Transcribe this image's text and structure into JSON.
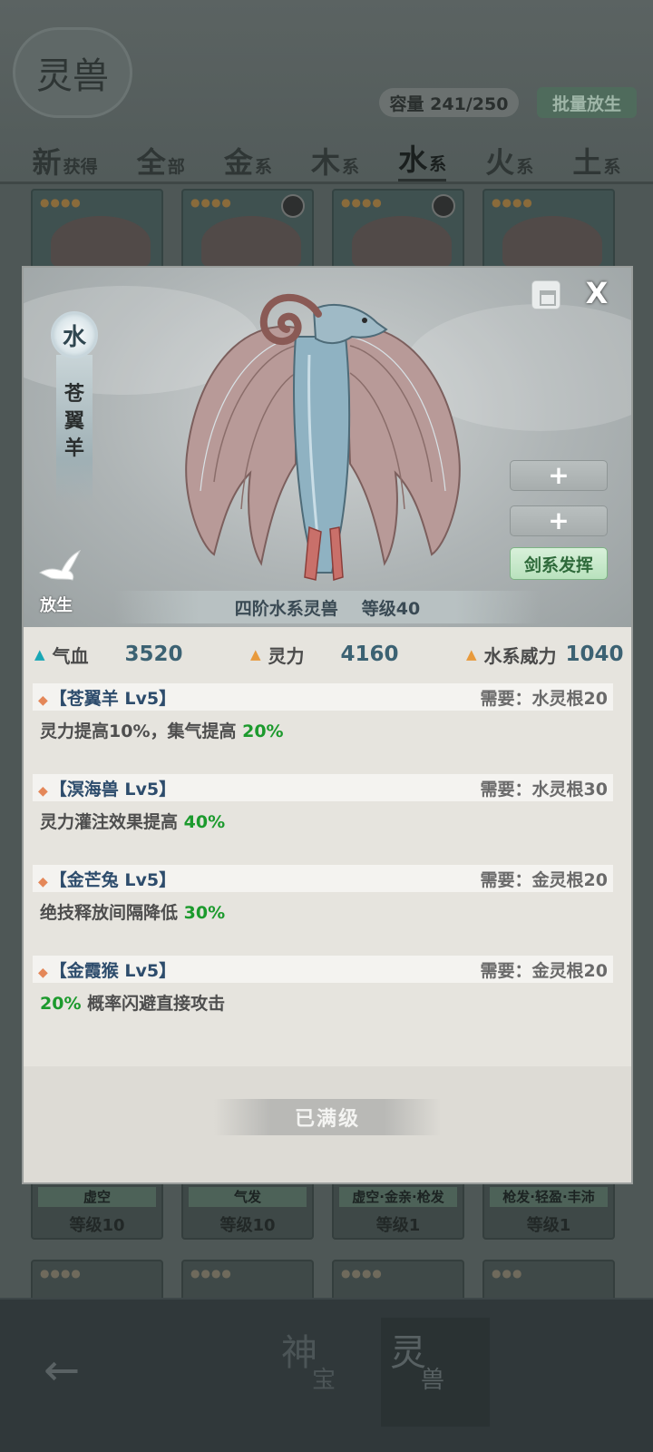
{
  "header": {
    "logo_text": "灵兽",
    "capacity": "容量 241/250",
    "batch_release": "批量放生"
  },
  "tabs": [
    {
      "big": "新",
      "small": "获得"
    },
    {
      "big": "全",
      "small": "部"
    },
    {
      "big": "金",
      "small": "系"
    },
    {
      "big": "木",
      "small": "系"
    },
    {
      "big": "水",
      "small": "系"
    },
    {
      "big": "火",
      "small": "系"
    },
    {
      "big": "土",
      "small": "系"
    }
  ],
  "background_cards_bottom": [
    {
      "tag": "虚空",
      "level": "等级10"
    },
    {
      "tag": "气发",
      "level": "等级10"
    },
    {
      "tag": "虚空·金亲·枪发",
      "level": "等级1"
    },
    {
      "tag": "枪发·轻盈·丰沛",
      "level": "等级1"
    }
  ],
  "bottom_nav": {
    "item1": {
      "big": "神",
      "small": "宝"
    },
    "item2": {
      "big": "灵",
      "small": "兽"
    }
  },
  "modal": {
    "element": "水",
    "beast_name": [
      "苍",
      "翼",
      "羊"
    ],
    "plus1": "+",
    "plus2": "+",
    "skill_button": "剑系发挥",
    "release_label": "放生",
    "rank": "四阶水系灵兽",
    "level": "等级40",
    "close": "X",
    "stats": [
      {
        "label": "气血",
        "value": "3520",
        "color": "#19a7b5"
      },
      {
        "label": "灵力",
        "value": "4160",
        "color": "#e89a3c"
      },
      {
        "label": "水系威力",
        "value": "1040",
        "color": "#e89a3c"
      }
    ],
    "skills": [
      {
        "name": "【苍翼羊 Lv5】",
        "req": "需要：水灵根20",
        "desc_pre": "",
        "desc": "灵力提高10%，集气提高",
        "highlight": "20%"
      },
      {
        "name": "【溟海兽 Lv5】",
        "req": "需要：水灵根30",
        "desc_pre": "",
        "desc": "灵力灌注效果提高",
        "highlight": "40%"
      },
      {
        "name": "【金芒兔 Lv5】",
        "req": "需要：金灵根20",
        "desc_pre": "",
        "desc": "绝技释放间隔降低",
        "highlight": "30%"
      },
      {
        "name": "【金霞猴 Lv5】",
        "req": "需要：金灵根20",
        "desc_pre": "20%",
        "desc": "概率闪避直接攻击",
        "highlight": ""
      }
    ],
    "maxed_label": "已满级"
  }
}
